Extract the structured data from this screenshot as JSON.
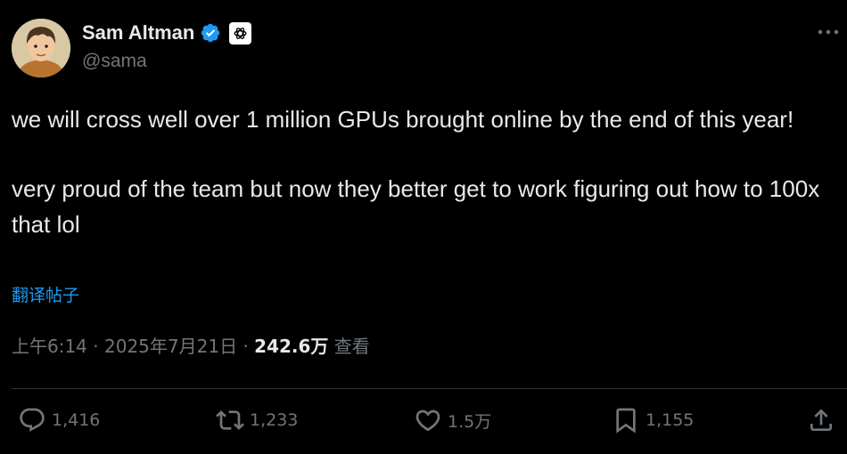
{
  "author": {
    "name": "Sam Altman",
    "handle": "@sama"
  },
  "tweet": {
    "paragraph1": "we will cross well over 1 million GPUs brought online by the end of this year!",
    "paragraph2": "very proud of the team but now they better get to work figuring out how to 100x that lol",
    "translate_label": "翻译帖子"
  },
  "meta": {
    "time": "上午6:14",
    "separator": "·",
    "date": "2025年7月21日",
    "views_count": "242.6万",
    "views_label": "查看"
  },
  "actions": {
    "replies": "1,416",
    "reposts": "1,233",
    "likes": "1.5万",
    "bookmarks": "1,155"
  },
  "colors": {
    "background": "#000000",
    "text": "#e7e9ea",
    "muted": "#71767b",
    "accent": "#1d9bf0"
  },
  "icons": [
    "verified-badge-icon",
    "openai-logo-icon",
    "more-options-icon",
    "reply-icon",
    "repost-icon",
    "like-icon",
    "bookmark-icon",
    "share-icon"
  ]
}
